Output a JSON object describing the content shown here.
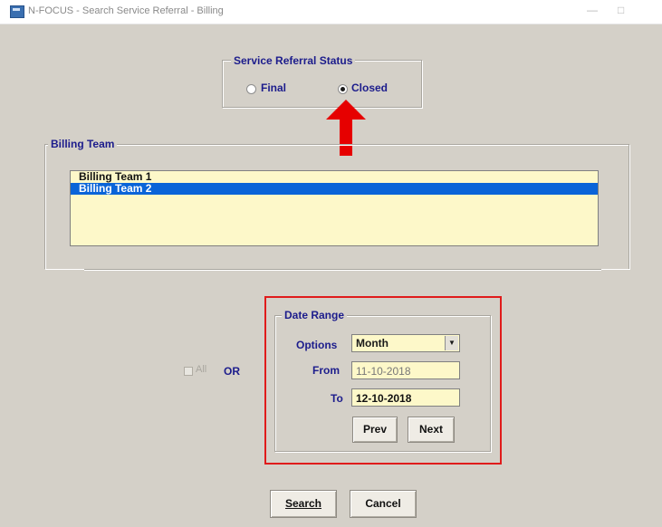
{
  "window": {
    "title": "N-FOCUS - Search Service Referral - Billing",
    "minimize_glyph": "—",
    "maximize_glyph": "□"
  },
  "status_group": {
    "label": "Service Referral Status",
    "options": [
      {
        "label": "Final",
        "selected": false
      },
      {
        "label": "Closed",
        "selected": true
      }
    ]
  },
  "annotation": {
    "arrow_color": "#e60000",
    "highlight_color": "#e01b1b"
  },
  "billing_team": {
    "label": "Billing Team",
    "items": [
      {
        "label": "Billing Team 1",
        "selected": false
      },
      {
        "label": "Billing Team 2",
        "selected": true
      }
    ]
  },
  "all_checkbox": {
    "label": "All",
    "checked": false,
    "enabled": false
  },
  "or_label": "OR",
  "date_range": {
    "label": "Date Range",
    "options_label": "Options",
    "option_value": "Month",
    "from_label": "From",
    "from_value": "11-10-2018",
    "to_label": "To",
    "to_value": "12-10-2018",
    "prev_label": "Prev",
    "next_label": "Next"
  },
  "actions": {
    "search_label": "Search",
    "cancel_label": "Cancel"
  },
  "colors": {
    "field_bg": "#fdf8c9",
    "selection": "#0a64d8",
    "label_navy": "#1c1c8c",
    "dialog_bg": "#d4d0c8"
  }
}
